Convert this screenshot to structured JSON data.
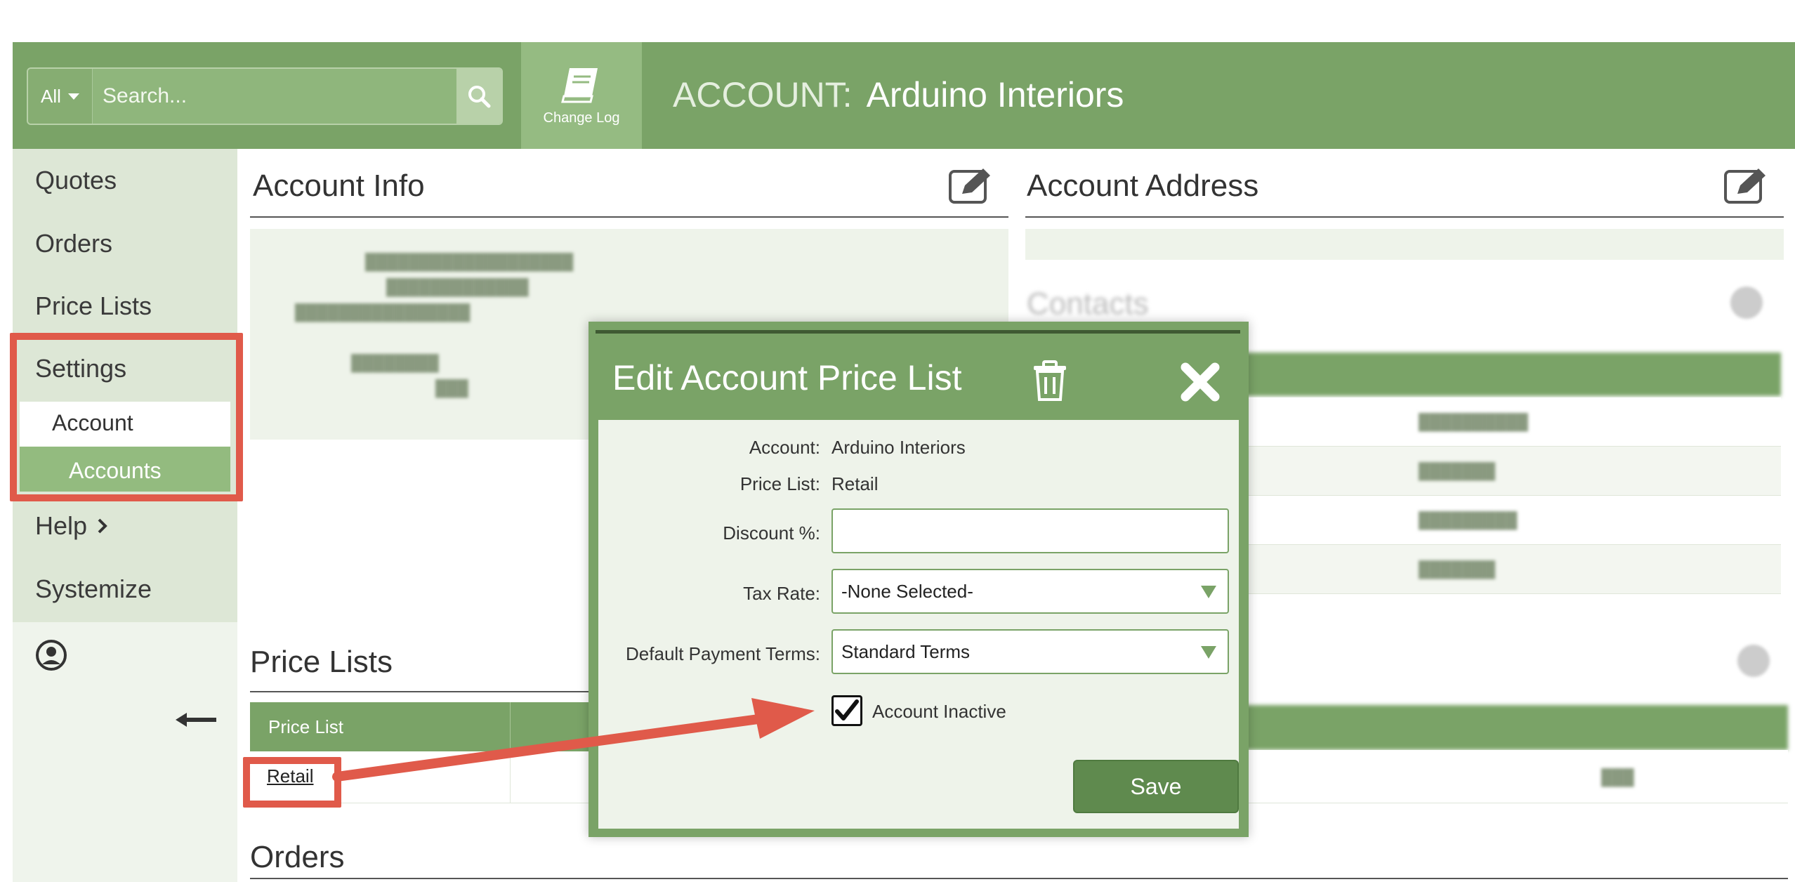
{
  "header": {
    "search_scope": "All",
    "search_placeholder": "Search...",
    "changelog_label": "Change Log",
    "account_prefix": "ACCOUNT:",
    "account_name": "Arduino Interiors"
  },
  "sidebar": {
    "items": [
      "Quotes",
      "Orders",
      "Price Lists",
      "Settings",
      "Account",
      "Accounts",
      "Help",
      "Systemize"
    ]
  },
  "main": {
    "account_info_title": "Account Info",
    "account_address_title": "Account Address",
    "contacts_title": "Contacts",
    "price_lists_title": "Price Lists",
    "orders_title": "Orders",
    "price_list_col": "Price List",
    "price_list_row": "Retail"
  },
  "modal": {
    "title": "Edit Account Price List",
    "account_label": "Account:",
    "account_value": "Arduino Interiors",
    "price_list_label": "Price List:",
    "price_list_value": "Retail",
    "discount_label": "Discount %:",
    "discount_value": "",
    "tax_rate_label": "Tax Rate:",
    "tax_rate_value": "-None Selected-",
    "payment_terms_label": "Default Payment Terms:",
    "payment_terms_value": "Standard Terms",
    "inactive_label": "Account Inactive",
    "inactive_checked": true,
    "save_label": "Save"
  },
  "colors": {
    "header_green": "#7aa367",
    "highlight_red": "#e05a4a"
  }
}
